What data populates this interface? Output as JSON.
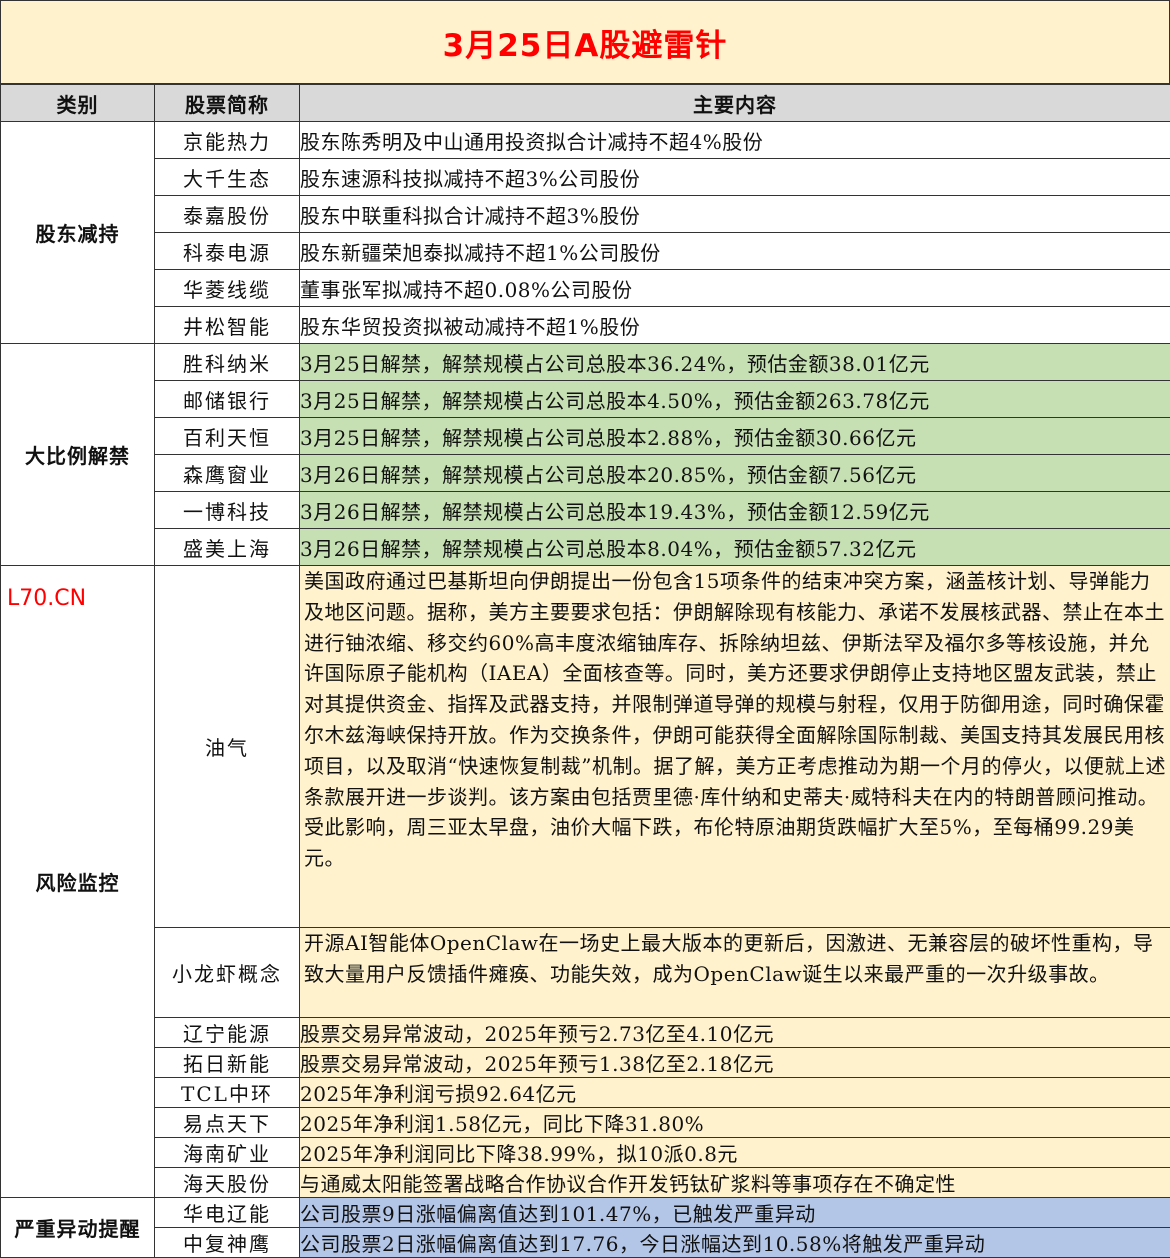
{
  "title": "3月25日A股避雷针",
  "headers": {
    "category": "类别",
    "stock": "股票简称",
    "content": "主要内容"
  },
  "watermark": "L70.CN",
  "colors": {
    "title_bg": "#fff2cc",
    "red": "#ff0000",
    "green": "#c6e0b4",
    "yellow": "#fff2cc",
    "blue": "#b4c6e7",
    "header_bg": "#d9d9d9"
  },
  "sections": {
    "reduce": {
      "label": "股东减持",
      "rows": [
        {
          "name": "京能热力",
          "content": "股东陈秀明及中山通用投资拟合计减持不超4%股份"
        },
        {
          "name": "大千生态",
          "content": "股东速源科技拟减持不超3%公司股份"
        },
        {
          "name": "泰嘉股份",
          "content": "股东中联重科拟合计减持不超3%股份"
        },
        {
          "name": "科泰电源",
          "content": "股东新疆荣旭泰拟减持不超1%公司股份"
        },
        {
          "name": "华菱线缆",
          "content": "董事张军拟减持不超0.08%公司股份"
        },
        {
          "name": "井松智能",
          "content": "股东华贸投资拟被动减持不超1%股份"
        }
      ]
    },
    "unlock": {
      "label": "大比例解禁",
      "rows": [
        {
          "name": "胜科纳米",
          "content": "3月25日解禁，解禁规模占公司总股本36.24%，预估金额38.01亿元"
        },
        {
          "name": "邮储银行",
          "content": "3月25日解禁，解禁规模占公司总股本4.50%，预估金额263.78亿元"
        },
        {
          "name": "百利天恒",
          "content": "3月25日解禁，解禁规模占公司总股本2.88%，预估金额30.66亿元"
        },
        {
          "name": "森鹰窗业",
          "content": "3月26日解禁，解禁规模占公司总股本20.85%，预估金额7.56亿元"
        },
        {
          "name": "一博科技",
          "content": "3月26日解禁，解禁规模占公司总股本19.43%，预估金额12.59亿元"
        },
        {
          "name": "盛美上海",
          "content": "3月26日解禁，解禁规模占公司总股本8.04%，预估金额57.32亿元"
        }
      ]
    },
    "risk": {
      "label": "风险监控",
      "oil": {
        "name": "油气",
        "content": "美国政府通过巴基斯坦向伊朗提出一份包含15项条件的结束冲突方案，涵盖核计划、导弹能力及地区问题。据称，美方主要要求包括：伊朗解除现有核能力、承诺不发展核武器、禁止在本土进行铀浓缩、移交约60%高丰度浓缩铀库存、拆除纳坦兹、伊斯法罕及福尔多等核设施，并允许国际原子能机构（IAEA）全面核查等。同时，美方还要求伊朗停止支持地区盟友武装，禁止对其提供资金、指挥及武器支持，并限制弹道导弹的规模与射程，仅用于防御用途，同时确保霍尔木兹海峡保持开放。作为交换条件，伊朗可能获得全面解除国际制裁、美国支持其发展民用核项目，以及取消“快速恢复制裁”机制。据了解，美方正考虑推动为期一个月的停火，以便就上述条款展开进一步谈判。该方案由包括贾里德·库什纳和史蒂夫·威特科夫在内的特朗普顾问推动。",
        "content2": "受此影响，周三亚太早盘，油价大幅下跌，布伦特原油期货跌幅扩大至5%，至每桶99.29美元。"
      },
      "lobster": {
        "name": "小龙虾概念",
        "content": "开源AI智能体OpenClaw在一场史上最大版本的更新后，因激进、无兼容层的破坏性重构，导致大量用户反馈插件瘫痪、功能失效，成为OpenClaw诞生以来最严重的一次升级事故。"
      },
      "rows": [
        {
          "name": "辽宁能源",
          "content": "股票交易异常波动，2025年预亏2.73亿至4.10亿元"
        },
        {
          "name": "拓日新能",
          "content": "股票交易异常波动，2025年预亏1.38亿至2.18亿元"
        },
        {
          "name": "TCL中环",
          "content": "2025年净利润亏损92.64亿元"
        },
        {
          "name": "易点天下",
          "content": "2025年净利润1.58亿元，同比下降31.80%"
        },
        {
          "name": "海南矿业",
          "content": "2025年净利润同比下降38.99%，拟10派0.8元"
        },
        {
          "name": "海天股份",
          "content": "与通威太阳能签署战略合作协议合作开发钙钛矿浆料等事项存在不确定性"
        }
      ]
    },
    "severe": {
      "label": "严重异动提醒",
      "rows": [
        {
          "name": "华电辽能",
          "content": "公司股票9日涨幅偏离值达到101.47%，已触发严重异动"
        },
        {
          "name": "中复神鹰",
          "content": "公司股票2日涨幅偏离值达到17.76，今日涨幅达到10.58%将触发严重异动"
        }
      ]
    }
  }
}
